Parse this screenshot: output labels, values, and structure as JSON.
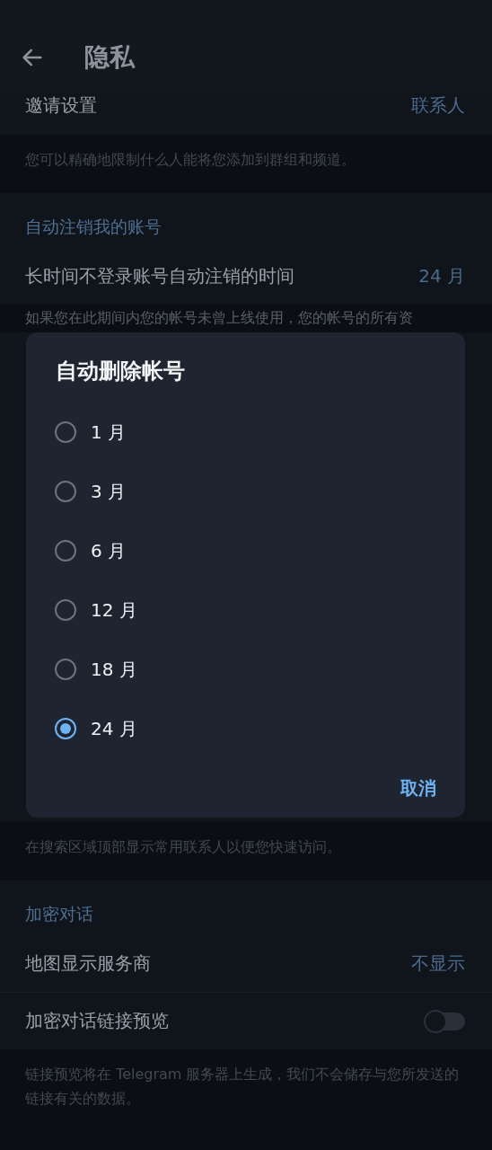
{
  "header": {
    "title": "隐私"
  },
  "sections": [
    {
      "rows": [
        {
          "kind": "value",
          "label": "邀请设置",
          "value": "联系人"
        }
      ],
      "hint": "您可以精确地限制什么人能将您添加到群组和频道。"
    },
    {
      "header": "自动注销我的账号",
      "rows": [
        {
          "kind": "value",
          "label": "长时间不登录账号自动注销的时间",
          "value": "24 月"
        }
      ],
      "hint": "如果您在此期间内您的帐号未曾上线使用，您的帐号的所有资"
    },
    {
      "hint": "在搜索区域顶部显示常用联系人以便您快速访问。"
    },
    {
      "header": "加密对话",
      "rows": [
        {
          "kind": "value",
          "label": "地图显示服务商",
          "value": "不显示"
        },
        {
          "kind": "toggle",
          "label": "加密对话链接预览",
          "on": false
        }
      ],
      "hint": "链接预览将在 Telegram 服务器上生成，我们不会储存与您所发送的链接有关的数据。"
    }
  ],
  "dialog": {
    "title": "自动删除帐号",
    "options": [
      {
        "label": "1 月",
        "selected": false
      },
      {
        "label": "3 月",
        "selected": false
      },
      {
        "label": "6 月",
        "selected": false
      },
      {
        "label": "12 月",
        "selected": false
      },
      {
        "label": "18 月",
        "selected": false
      },
      {
        "label": "24 月",
        "selected": true
      }
    ],
    "buttons": [
      "取消"
    ]
  }
}
